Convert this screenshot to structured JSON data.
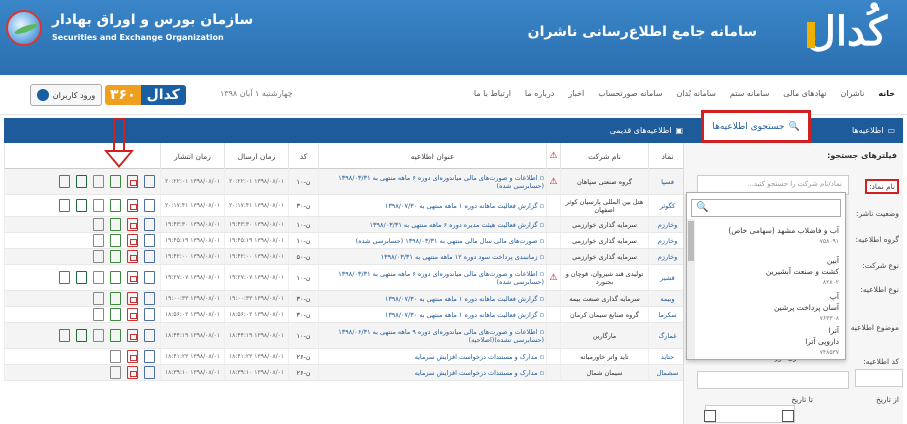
{
  "header": {
    "sebo_title_fa": "سازمان بورس و اوراق بهادار",
    "sebo_title_en": "Securities and Exchange Organization",
    "codal_logo": "کُدال",
    "codal_title": "سامانه جامع اطلاع‌رسانی ناشران"
  },
  "nav": {
    "items": [
      "خانه",
      "ناشران",
      "نهادهای مالی",
      "سامانه ستم",
      "سامانه بُدان",
      "سامانه صورتحساب",
      "اخبار",
      "درباره ما",
      "ارتباط با ما"
    ],
    "login_label": "ورود کاربران",
    "codal360_a": "کدال",
    "codal360_b": "۳۶۰",
    "date": "چهارشنبه ۱ آبان ۱۳۹۸"
  },
  "tabs": {
    "announcements": "اطلاعیه‌ها",
    "search": "جستجوی اطلاعیه‌ها",
    "old": "اطلاعیه‌های قدیمی"
  },
  "filters": {
    "title": "فیلترهای جستجو:",
    "symbol_label": "نام نماد:",
    "symbol_placeholder": "نماد/نام شرکت را جستجو کنید...",
    "publisher_status": "وضعیت ناشر:",
    "group": "گروه اطلاعیه:",
    "company_type": "نوع شرکت:",
    "ann_type": "نوع اطلاعیه:",
    "subject": "موضوع اطلاعیه",
    "code": "کد اطلاعیه:",
    "period": "طول دوره",
    "from_date": "از تاریخ",
    "to_date": "تا تاریخ",
    "dropdown_items": [
      {
        "name": "آب و فاضلاب مشهد (سهامی خاص)",
        "code": "۷۵۸۰۹۱"
      },
      {
        "name": "آبین",
        "name2": "کشت و صنعت آبشیرین",
        "code": "۸۲۸۰۲"
      },
      {
        "name": "آپ",
        "name2": "آسان پرداخت پرشین",
        "code": "۷۶۳۳۰۸"
      },
      {
        "name": "آترا",
        "name2": "داروپی آترا",
        "code": "۷۴۸۵۳۷"
      }
    ]
  },
  "table": {
    "headers": [
      "نماد",
      "نام شرکت",
      "",
      "عنوان اطلاعیه",
      "کد",
      "زمان ارسال",
      "زمان انتشار"
    ],
    "rows": [
      {
        "symbol": "فسپا",
        "company": "گروه صنعتی سپاهان",
        "warn": true,
        "title": "اطلاعات و صورت‌های مالی میاندوره‌ای دوره ۶ ماهه منتهی به ۱۳۹۸/۰۳/۳۱ (حسابرسی شده)",
        "code": "ن-۱۰",
        "sent": "۱۳۹۸/۰۸/۰۱ ۲۰:۲۲:۰۱",
        "published": "۱۳۹۸/۰۸/۰۱ ۲۰:۲۲:۰۱"
      },
      {
        "symbol": "کگوثر",
        "company": "هتل بین المللی پارسیان کوثر اصفهان",
        "warn": false,
        "title": "گزارش فعالیت ماهانه دوره ۱ ماهه منتهی به ۱۳۹۸/۰۷/۳۰",
        "code": "ن-۳۰",
        "sent": "۱۳۹۸/۰۸/۰۱ ۲۰:۱۷:۴۱",
        "published": "۱۳۹۸/۰۸/۰۱ ۲۰:۱۷:۴۱"
      },
      {
        "symbol": "وخارزم",
        "company": "سرمایه گذاری خوارزمی",
        "warn": false,
        "title": "گزارش فعالیت هیئت مدیره دوره ۶ ماهه منتهی به ۱۳۹۸/۰۳/۳۱",
        "code": "ن-۱۰",
        "sent": "۱۳۹۸/۰۸/۰۱ ۱۹:۴۳:۳۰",
        "published": "۱۳۹۸/۰۸/۰۱ ۱۹:۴۳:۳۰"
      },
      {
        "symbol": "وخارزم",
        "company": "سرمایه گذاری خوارزمی",
        "warn": false,
        "title": "صورت‌های مالی سال مالی منتهی به ۱۳۹۸/۰۳/۳۱ (حسابرسی شده)",
        "code": "ن-۱۰",
        "sent": "۱۳۹۸/۰۸/۰۱ ۱۹:۴۵:۱۹",
        "published": "۱۳۹۸/۰۸/۰۱ ۱۹:۴۵:۱۹"
      },
      {
        "symbol": "وخارزم",
        "company": "سرمایه گذاری خوارزمی",
        "warn": false,
        "title": "زمانبندی پرداخت سود دوره ۱۲ ماهه منتهی به ۱۳۹۸/۰۳/۳۱",
        "code": "ن-۵۰",
        "sent": "۱۳۹۸/۰۸/۰۱ ۱۹:۴۲:۰۰",
        "published": "۱۳۹۸/۰۸/۰۱ ۱۹:۴۲:۰۰"
      },
      {
        "symbol": "قشیر",
        "company": "تولیدی قند شیروان، قوچان و بجنورد",
        "warn": true,
        "title": "اطلاعات و صورت‌های مالی میاندوره‌ای دوره ۶ ماهه منتهی به ۱۳۹۸/۰۳/۳۱ (حسابرسی شده)",
        "code": "ن-۱۰",
        "sent": "۱۳۹۸/۰۸/۰۱ ۱۹:۲۷:۰۷",
        "published": "۱۳۹۸/۰۸/۰۱ ۱۹:۲۷:۰۷"
      },
      {
        "symbol": "وبیمه",
        "company": "سرمایه گذاری صنعت بیمه",
        "warn": false,
        "title": "گزارش فعالیت ماهانه دوره ۱ ماهه منتهی به ۱۳۹۸/۰۷/۳۰",
        "code": "ن-۳۰",
        "sent": "۱۳۹۸/۰۸/۰۱ ۱۹:۰۰:۳۳",
        "published": "۱۳۹۸/۰۸/۰۱ ۱۹:۰۰:۳۳"
      },
      {
        "symbol": "سکرما",
        "company": "گروه صنایع سیمان کرمان",
        "warn": false,
        "title": "گزارش فعالیت ماهانه دوره ۱ ماهه منتهی به ۱۳۹۸/۰۷/۳۰",
        "code": "ن-۳۰",
        "sent": "۱۳۹۸/۰۸/۰۱ ۱۸:۵۶:۰۲",
        "published": "۱۳۹۸/۰۸/۰۱ ۱۸:۵۶:۰۲"
      },
      {
        "symbol": "غمارگ",
        "company": "مارگارین",
        "warn": false,
        "title": "اطلاعات و صورت‌های مالی میاندوره‌ای دوره ۹ ماهه منتهی به ۱۳۹۸/۰۶/۳۱ (حسابرسی نشده)(اصلاحیه)",
        "code": "ن-۱۰",
        "sent": "۱۳۹۸/۰۸/۰۱ ۱۸:۴۴:۱۹",
        "published": "۱۳۹۸/۰۸/۰۱ ۱۸:۴۴:۱۹"
      },
      {
        "symbol": "حتاید",
        "company": "تاید واتر خاورمیانه",
        "warn": false,
        "title": "مدارک و مستندات درخواست افزایش سرمایه",
        "code": "ن-۲۶",
        "sent": "۱۳۹۸/۰۸/۰۱ ۱۸:۴۱:۲۳",
        "published": "۱۳۹۸/۰۸/۰۱ ۱۸:۴۱:۲۳"
      },
      {
        "symbol": "سشمال",
        "company": "سیمان شمال",
        "warn": false,
        "title": "مدارک و مستندات درخواست افزایش سرمایه",
        "code": "ن-۲۶",
        "sent": "۱۳۹۸/۰۸/۰۱ ۱۸:۳۹:۱۰",
        "published": "۱۳۹۸/۰۸/۰۱ ۱۸:۳۹:۱۰"
      }
    ]
  }
}
